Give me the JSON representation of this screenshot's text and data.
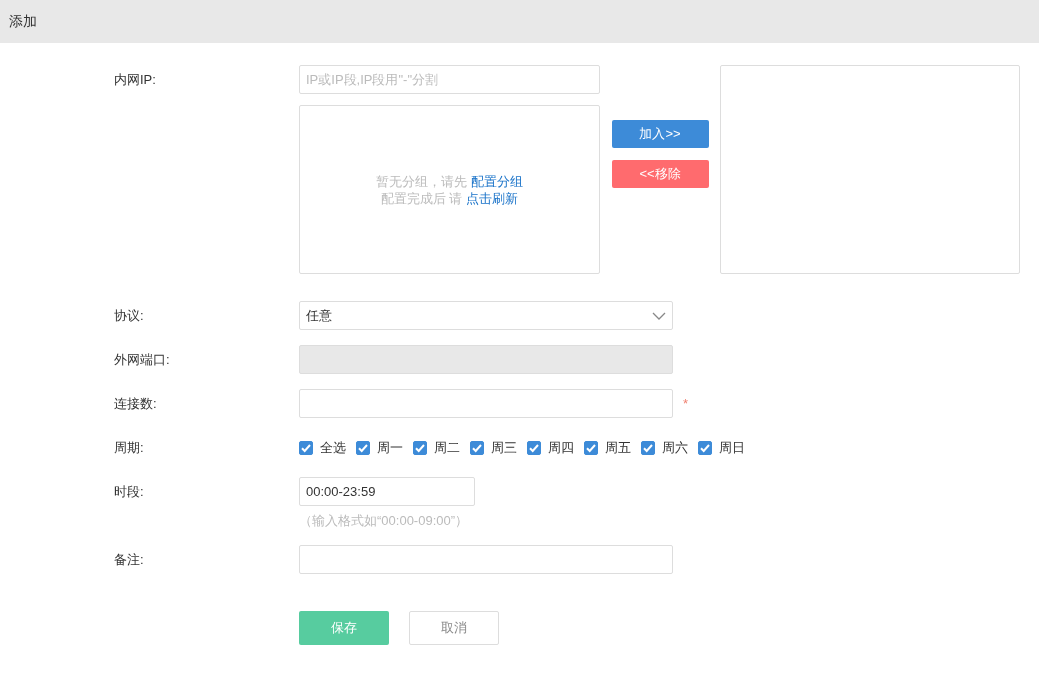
{
  "title": "添加",
  "intranet_ip": {
    "label": "内网IP:",
    "placeholder": "IP或IP段,IP段用\"-\"分割",
    "empty_notice": [
      {
        "text": "暂无分组，请先 ",
        "link": "配置分组"
      },
      {
        "text": "配置完成后 请 ",
        "link": "点击刷新"
      }
    ],
    "add_button": "加入>>",
    "remove_button": "<<移除"
  },
  "protocol": {
    "label": "协议:",
    "value": "任意"
  },
  "external_port": {
    "label": "外网端口:",
    "disabled": true
  },
  "connections": {
    "label": "连接数:",
    "required_mark": "*"
  },
  "period": {
    "label": "周期:",
    "options": [
      {
        "label": "全选",
        "checked": true
      },
      {
        "label": "周一",
        "checked": true
      },
      {
        "label": "周二",
        "checked": true
      },
      {
        "label": "周三",
        "checked": true
      },
      {
        "label": "周四",
        "checked": true
      },
      {
        "label": "周五",
        "checked": true
      },
      {
        "label": "周六",
        "checked": true
      },
      {
        "label": "周日",
        "checked": true
      }
    ]
  },
  "time_range": {
    "label": "时段:",
    "value": "00:00-23:59",
    "hint": "（输入格式如“00:00-09:00”）"
  },
  "remarks": {
    "label": "备注:"
  },
  "buttons": {
    "save": "保存",
    "cancel": "取消"
  }
}
